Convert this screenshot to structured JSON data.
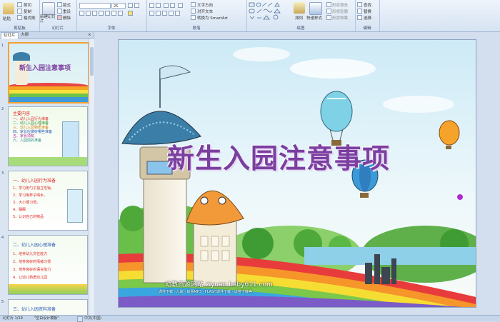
{
  "ribbon": {
    "clipboard": {
      "paste": "粘贴",
      "cut": "剪切",
      "copy": "复制",
      "format_painter": "格式刷",
      "label": "剪贴板"
    },
    "slides": {
      "new_slide": "新建幻灯片",
      "layout": "版式",
      "reset": "重设",
      "delete": "删除",
      "label": "幻灯片"
    },
    "font": {
      "font_name": "",
      "font_size": "25",
      "label": "字体"
    },
    "paragraph": {
      "text_direction": "文字方向",
      "align_text": "对齐文本",
      "smartart": "转换为 SmartArt",
      "label": "段落"
    },
    "drawing": {
      "arrange": "排列",
      "quick_styles": "快速样式",
      "shape_fill": "形状填充",
      "shape_outline": "形状轮廓",
      "shape_effects": "形状效果",
      "label": "绘图"
    },
    "editing": {
      "find": "查找",
      "replace": "替换",
      "select": "选择",
      "label": "编辑"
    }
  },
  "panel": {
    "tab_slides": "幻灯片",
    "tab_outline": "大纲",
    "thumbs": [
      {
        "num": "1",
        "title": "新生入园注意事项"
      },
      {
        "num": "2",
        "title": "主要内容",
        "lines": [
          "一、幼儿入园行为准备",
          "二、幼儿入园心理准备",
          "三、幼儿入园物质准备",
          "四、家长应做好哪些准备",
          "五、家长须知",
          "六、入园前的准备"
        ]
      },
      {
        "num": "3",
        "title": "一、幼儿入园行为准备",
        "lines": [
          "1、学习用勺子独立吃饭。",
          "2、学习用杯子喝水。",
          "3、大小便习惯。",
          "4、睡眠",
          "5、认识自己的物品"
        ]
      },
      {
        "num": "4",
        "title": "二、幼儿入园心理准备",
        "lines": [
          "1、培养幼儿交往能力",
          "2、培养良好的情绪习惯",
          "3、培养良好的语言能力",
          "4、让幼儿熟悉幼儿园"
        ]
      },
      {
        "num": "5",
        "title": "三、幼儿入园资料准备"
      }
    ]
  },
  "slide": {
    "title": "新生入园注意事项",
    "footer": "幼教资源网站 ziyuan.baby611.com",
    "footer_sub": "课件下载 · 儿歌 · 故事MP3 · FLASH课件下载 · 试卷下载等"
  },
  "status": {
    "slide_count": "幻灯片 1/19",
    "theme": "\"空白设计模板\"",
    "language": "中文(中国)"
  },
  "colors": {
    "title_purple": "#7b3fa0",
    "ribbon_bg": "#dce7f5",
    "selection": "#f2a23a"
  }
}
